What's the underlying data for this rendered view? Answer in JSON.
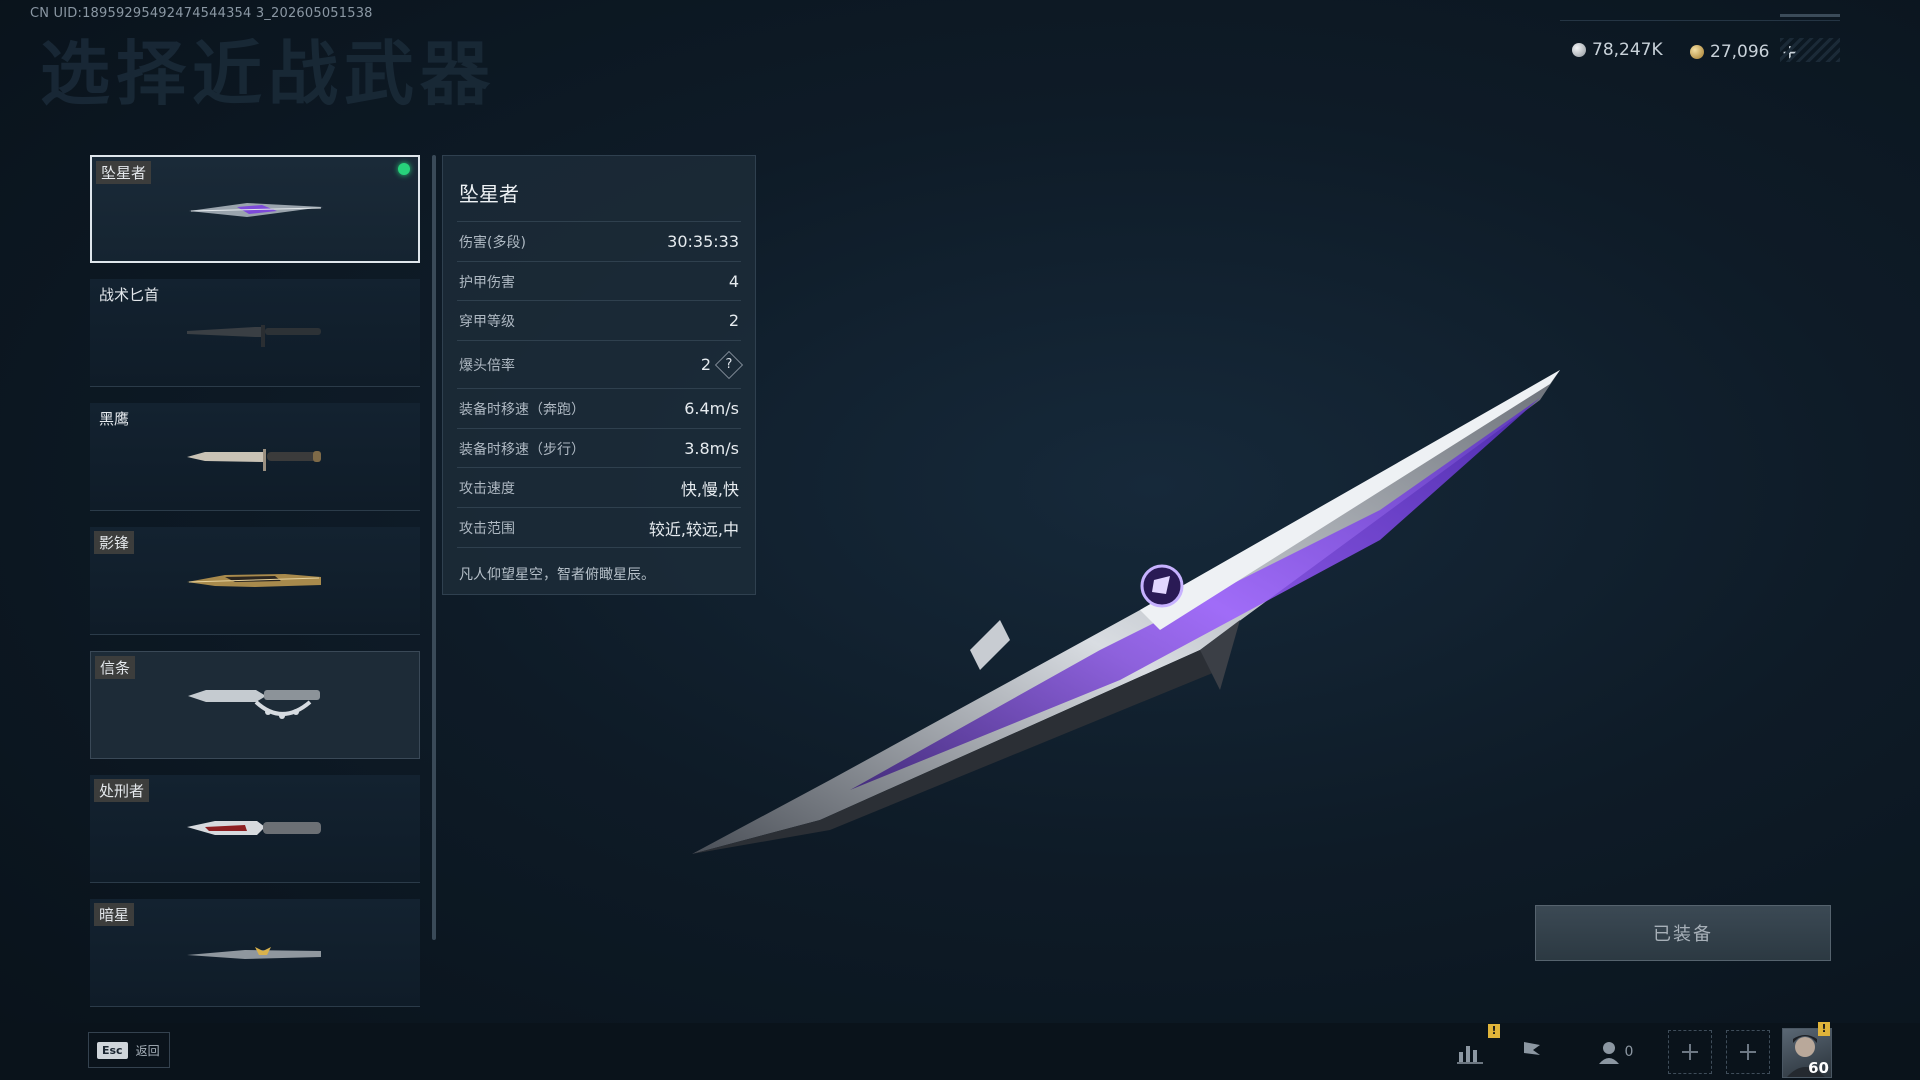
{
  "watermark_uid": "CN UID:18959295492474544354 3_202605051538",
  "page_title": "选择近战武器",
  "currency": {
    "silver": "78,247K",
    "gold": "27,096",
    "add": "+"
  },
  "weapons": [
    {
      "name": "坠星者",
      "selected": true,
      "equipped": true
    },
    {
      "name": "战术匕首",
      "selected": false,
      "equipped": false
    },
    {
      "name": "黑鹰",
      "selected": false,
      "equipped": false
    },
    {
      "name": "影锋",
      "selected": false,
      "equipped": false
    },
    {
      "name": "信条",
      "selected": false,
      "equipped": false
    },
    {
      "name": "处刑者",
      "selected": false,
      "equipped": false
    },
    {
      "name": "暗星",
      "selected": false,
      "equipped": false
    }
  ],
  "stats": {
    "title": "坠星者",
    "rows": [
      {
        "label": "伤害(多段)",
        "value": "30:35:33"
      },
      {
        "label": "护甲伤害",
        "value": "4"
      },
      {
        "label": "穿甲等级",
        "value": "2"
      },
      {
        "label": "爆头倍率",
        "value": "2"
      },
      {
        "label": "装备时移速（奔跑）",
        "value": "6.4m/s"
      },
      {
        "label": "装备时移速（步行）",
        "value": "3.8m/s"
      },
      {
        "label": "攻击速度",
        "value": "快,慢,快"
      },
      {
        "label": "攻击范围",
        "value": "较近,较远,中"
      }
    ],
    "help": "?",
    "flavor": "凡人仰望星空，智者俯瞰星辰。"
  },
  "equip_button": "已装备",
  "bottom": {
    "esc_key": "Esc",
    "esc_label": "返回",
    "friends_count": "0",
    "warn": "!",
    "player_level": "60"
  },
  "colors": {
    "accent_purple": "#8a4dff",
    "equipped_dot": "#27d37b",
    "warning": "#e0b43a"
  }
}
